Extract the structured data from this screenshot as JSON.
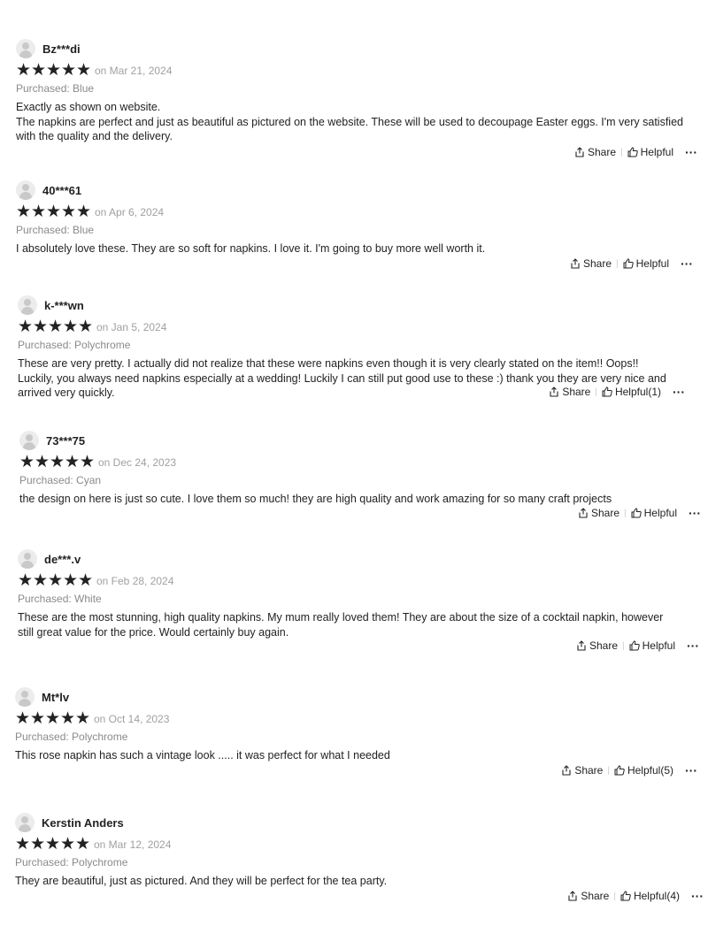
{
  "share_label": "Share",
  "more_label": "···",
  "reviews": [
    {
      "user": "Bz***di",
      "date": "on Mar 21, 2024",
      "purchased": "Purchased: Blue",
      "title": "Exactly as shown on website.",
      "text": "The napkins are perfect and just as beautiful as pictured on the website. These will be used to decoupage Easter eggs. I'm very satisfied with the quality and the delivery.",
      "helpful": "Helpful",
      "rating": 5
    },
    {
      "user": "40***61",
      "date": "on Apr 6, 2024",
      "purchased": "Purchased: Blue",
      "title": "",
      "text": "I absolutely love these. They are so soft for napkins. I love it. I'm going to buy more well worth it.",
      "helpful": "Helpful",
      "rating": 5
    },
    {
      "user": "k-***wn",
      "date": "on Jan 5, 2024",
      "purchased": "Purchased: Polychrome",
      "title": "",
      "text": "These are very pretty. I actually did not realize that these were napkins even though it is very clearly stated on the item!! Oops!! Luckily, you always need napkins especially at a wedding! Luckily I can still put good use to these :) thank you they are very nice and arrived very quickly.",
      "helpful": "Helpful(1)",
      "rating": 5
    },
    {
      "user": "73***75",
      "date": "on Dec 24, 2023",
      "purchased": "Purchased: Cyan",
      "title": "",
      "text": "the design on here is just so cute. I love them so much! they are high quality and work amazing for so many craft projects",
      "helpful": "Helpful",
      "rating": 5
    },
    {
      "user": "de***.v",
      "date": "on Feb 28, 2024",
      "purchased": "Purchased: White",
      "title": "",
      "text": "These are the most stunning, high quality napkins. My mum really loved them! They are about the size of a cocktail napkin, however still great value for the price. Would certainly buy again.",
      "helpful": "Helpful",
      "rating": 5
    },
    {
      "user": "Mt*lv",
      "date": "on Oct 14, 2023",
      "purchased": "Purchased: Polychrome",
      "title": "",
      "text": "This rose napkin has such a vintage look ..... it was perfect for what I needed",
      "helpful": "Helpful(5)",
      "rating": 5
    },
    {
      "user": "Kerstin Anders",
      "date": "on Mar 12, 2024",
      "purchased": "Purchased: Polychrome",
      "title": "",
      "text": "They are beautiful, just as pictured. And they will be perfect for the tea party.",
      "helpful": "Helpful(4)",
      "rating": 5
    }
  ]
}
